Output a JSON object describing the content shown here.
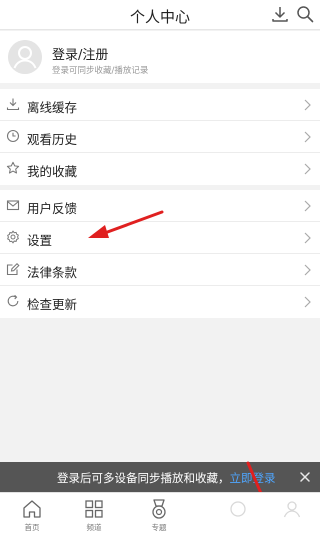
{
  "header": {
    "title": "个人中心"
  },
  "profile": {
    "title": "登录/注册",
    "subtitle": "登录可同步收藏/播放记录"
  },
  "menu_group_1": [
    {
      "label": "离线缓存",
      "icon": "download-icon"
    },
    {
      "label": "观看历史",
      "icon": "clock-icon"
    },
    {
      "label": "我的收藏",
      "icon": "star-icon"
    }
  ],
  "menu_group_2": [
    {
      "label": "用户反馈",
      "icon": "mail-icon"
    },
    {
      "label": "设置",
      "icon": "gear-icon"
    },
    {
      "label": "法律条款",
      "icon": "edit-icon"
    },
    {
      "label": "检查更新",
      "icon": "refresh-icon"
    }
  ],
  "banner": {
    "text": "登录后可多设备同步播放和收藏，",
    "link": "立即登录"
  },
  "tabbar": [
    {
      "label": "首页",
      "icon": "home-icon"
    },
    {
      "label": "频道",
      "icon": "grid-icon"
    },
    {
      "label": "专题",
      "icon": "medal-icon"
    },
    {
      "label": "",
      "icon": "faded-tab-icon"
    },
    {
      "label": "",
      "icon": "user-tab-icon"
    }
  ],
  "colors": {
    "annotation_arrow": "#e02020",
    "link": "#4fa6ff",
    "banner_bg": "#555555"
  }
}
